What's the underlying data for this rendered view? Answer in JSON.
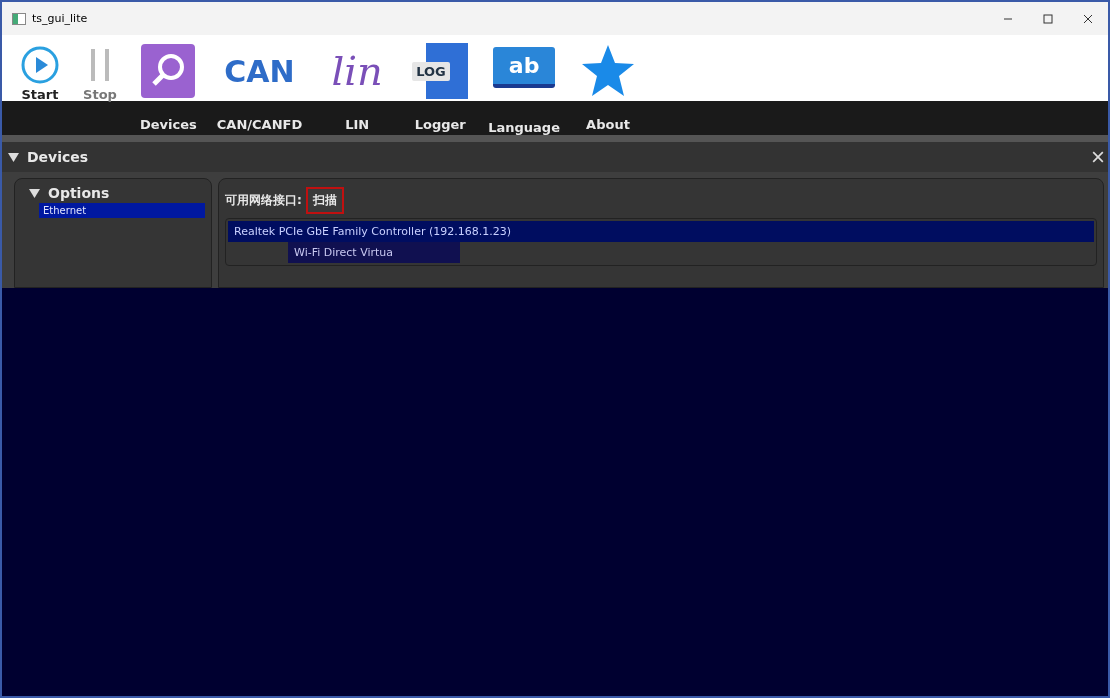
{
  "window": {
    "title": "ts_gui_lite"
  },
  "toolbar": [
    {
      "kind": "start",
      "label": "Start",
      "disabled": false
    },
    {
      "kind": "stop",
      "label": "Stop",
      "disabled": true
    },
    {
      "kind": "devices",
      "label": "Devices",
      "disabled": false
    },
    {
      "kind": "can",
      "icon_text": "CAN",
      "label": "CAN/CANFD",
      "disabled": false
    },
    {
      "kind": "lin",
      "icon_text": "lin",
      "label": "LIN",
      "disabled": false
    },
    {
      "kind": "logger",
      "icon_text": "LOG",
      "label": "Logger",
      "disabled": false
    },
    {
      "kind": "language",
      "icon_text": "ab",
      "label": "Language",
      "disabled": false
    },
    {
      "kind": "about",
      "label": "About",
      "disabled": false
    }
  ],
  "panel": {
    "title": "Devices",
    "expanded": true
  },
  "options": {
    "title": "Options",
    "expanded": true,
    "items": [
      {
        "label": "Ethernet",
        "selected": true
      }
    ]
  },
  "interfaces": {
    "label": "可用网络接口:",
    "scan_button": "扫描",
    "items": [
      {
        "label": "Realtek PCIe GbE Family Controller (192.168.1.23)",
        "selected": true
      },
      {
        "label": "Wi-Fi Direct Virtua",
        "selected": false
      }
    ]
  }
}
